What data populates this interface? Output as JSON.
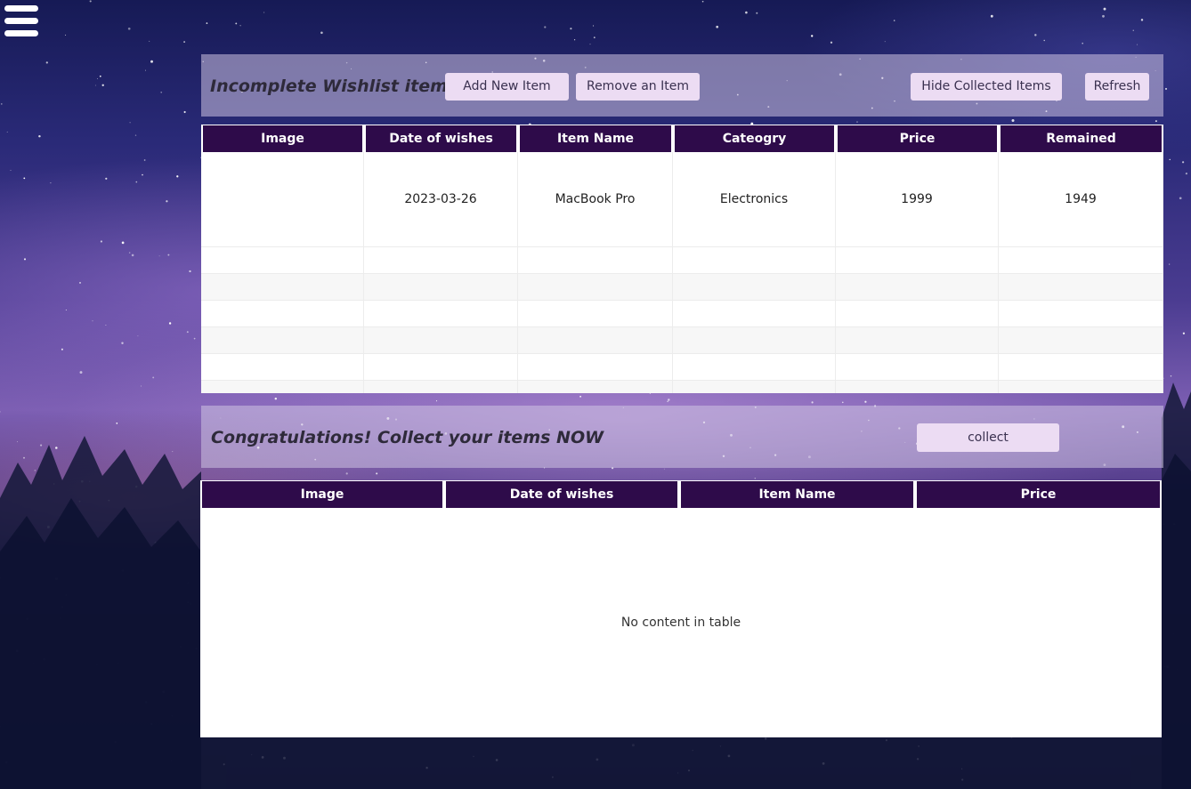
{
  "menu": {
    "icon": "hamburger-menu-icon"
  },
  "wishlist": {
    "title": "Incomplete Wishlist items",
    "buttons": {
      "add": "Add New Item",
      "remove": "Remove an Item",
      "hide": "Hide Collected Items",
      "refresh": "Refresh"
    },
    "columns": [
      "Image",
      "Date of wishes",
      "Item Name",
      "Cateogry",
      "Price",
      "Remained"
    ],
    "rows": [
      {
        "image": "",
        "date": "2023-03-26",
        "name": "MacBook Pro",
        "category": "Electronics",
        "price": "1999",
        "remained": "1949"
      }
    ]
  },
  "collect": {
    "title": "Congratulations! Collect your items NOW",
    "button": "collect",
    "columns": [
      "Image",
      "Date of wishes",
      "Item Name",
      "Price"
    ],
    "empty_text": "No content in table"
  },
  "colors": {
    "header_bg": "#2e0b4a",
    "button_bg": "#ecdcf3"
  }
}
